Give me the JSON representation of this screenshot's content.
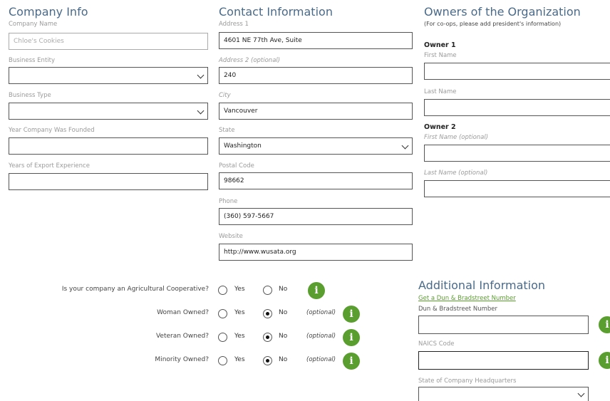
{
  "company": {
    "heading": "Company Info",
    "name_label": "Company Name",
    "name_value": "Chloe's Cookies",
    "entity_label": "Business Entity",
    "entity_value": "",
    "type_label": "Business Type",
    "type_value": "",
    "year_label": "Year Company Was Founded",
    "year_value": "",
    "export_label": "Years of Export Experience",
    "export_value": ""
  },
  "contact": {
    "heading": "Contact Information",
    "address1_label": "Address 1",
    "address1_value": "4601 NE 77th Ave, Suite",
    "address2_label": "Address 2 (optional)",
    "address2_value": "240",
    "city_label": "City",
    "city_value": "Vancouver",
    "state_label": "State",
    "state_value": "Washington",
    "postal_label": "Postal Code",
    "postal_value": "98662",
    "phone_label": "Phone",
    "phone_value": "(360) 597-5667",
    "website_label": "Website",
    "website_value": "http://www.wusata.org"
  },
  "owners": {
    "heading": "Owners of the Organization",
    "subheading": "(For co-ops, please add president's information)",
    "owner1_title": "Owner 1",
    "owner1_first_label": "First Name",
    "owner1_last_label": "Last Name",
    "owner2_title": "Owner 2",
    "owner2_first_label": "First Name (optional)",
    "owner2_last_label": "Last Name (optional)"
  },
  "questions": {
    "yes": "Yes",
    "no": "No",
    "optional": "(optional)",
    "info_glyph": "i",
    "coop": {
      "label": "Is your company an Agricultural Cooperative?",
      "selected": "none"
    },
    "woman": {
      "label": "Woman Owned?",
      "selected": "No"
    },
    "veteran": {
      "label": "Veteran Owned?",
      "selected": "No"
    },
    "minority": {
      "label": "Minority Owned?",
      "selected": "No"
    }
  },
  "additional": {
    "heading": "Additional Information",
    "dnb_link": "Get a Dun & Bradstreet Number",
    "dnb_label": "Dun & Bradstreet Number",
    "naics_label": "NAICS Code",
    "hq_label": "State of Company Headquarters"
  },
  "colors": {
    "heading": "#4a6a8a",
    "accent_green": "#5a9e2f"
  },
  "icons": [
    "chevron-down-icon",
    "info-icon",
    "radio-unselected-icon",
    "radio-selected-icon"
  ]
}
